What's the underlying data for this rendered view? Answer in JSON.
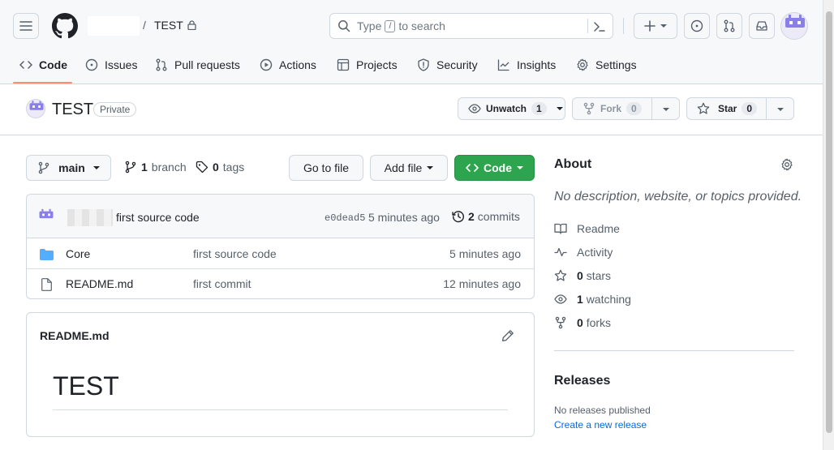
{
  "header": {
    "owner": "",
    "slash": "/",
    "repo_name": "TEST",
    "search_placeholder_pre": "Type",
    "search_key": "/",
    "search_placeholder_post": "to search"
  },
  "tabs": [
    {
      "label": "Code",
      "icon": "code-icon"
    },
    {
      "label": "Issues",
      "icon": "issue-icon"
    },
    {
      "label": "Pull requests",
      "icon": "pull-request-icon"
    },
    {
      "label": "Actions",
      "icon": "play-icon"
    },
    {
      "label": "Projects",
      "icon": "table-icon"
    },
    {
      "label": "Security",
      "icon": "shield-icon"
    },
    {
      "label": "Insights",
      "icon": "graph-icon"
    },
    {
      "label": "Settings",
      "icon": "gear-icon"
    }
  ],
  "repo": {
    "title": "TEST",
    "visibility": "Private",
    "unwatch_label": "Unwatch",
    "watch_count": "1",
    "fork_label": "Fork",
    "fork_count": "0",
    "star_label": "Star",
    "star_count": "0"
  },
  "toolbar": {
    "branch": "main",
    "branch_count": "1",
    "branch_word": "branch",
    "tag_count": "0",
    "tag_word": "tags",
    "goto_file": "Go to file",
    "add_file": "Add file",
    "code_button": "Code"
  },
  "commit": {
    "message": "first source code",
    "sha": "e0dead5",
    "time": "5 minutes ago",
    "commit_count": "2",
    "commit_word": "commits"
  },
  "files": [
    {
      "name": "Core",
      "type": "folder",
      "message": "first source code",
      "time": "5 minutes ago"
    },
    {
      "name": "README.md",
      "type": "file",
      "message": "first commit",
      "time": "12 minutes ago"
    }
  ],
  "readme": {
    "filename": "README.md",
    "heading": "TEST"
  },
  "about": {
    "title": "About",
    "description": "No description, website, or topics provided.",
    "readme_link": "Readme",
    "activity_link": "Activity",
    "stars_count": "0",
    "stars_word": "stars",
    "watching_count": "1",
    "watching_word": "watching",
    "forks_count": "0",
    "forks_word": "forks"
  },
  "releases": {
    "title": "Releases",
    "none_text": "No releases published",
    "create_link": "Create a new release"
  },
  "colors": {
    "accent_link": "#0969da",
    "green_button": "#2da44e",
    "tab_underline": "#fd8c73",
    "avatar": "#8a7fe8",
    "folder": "#54aeff"
  }
}
